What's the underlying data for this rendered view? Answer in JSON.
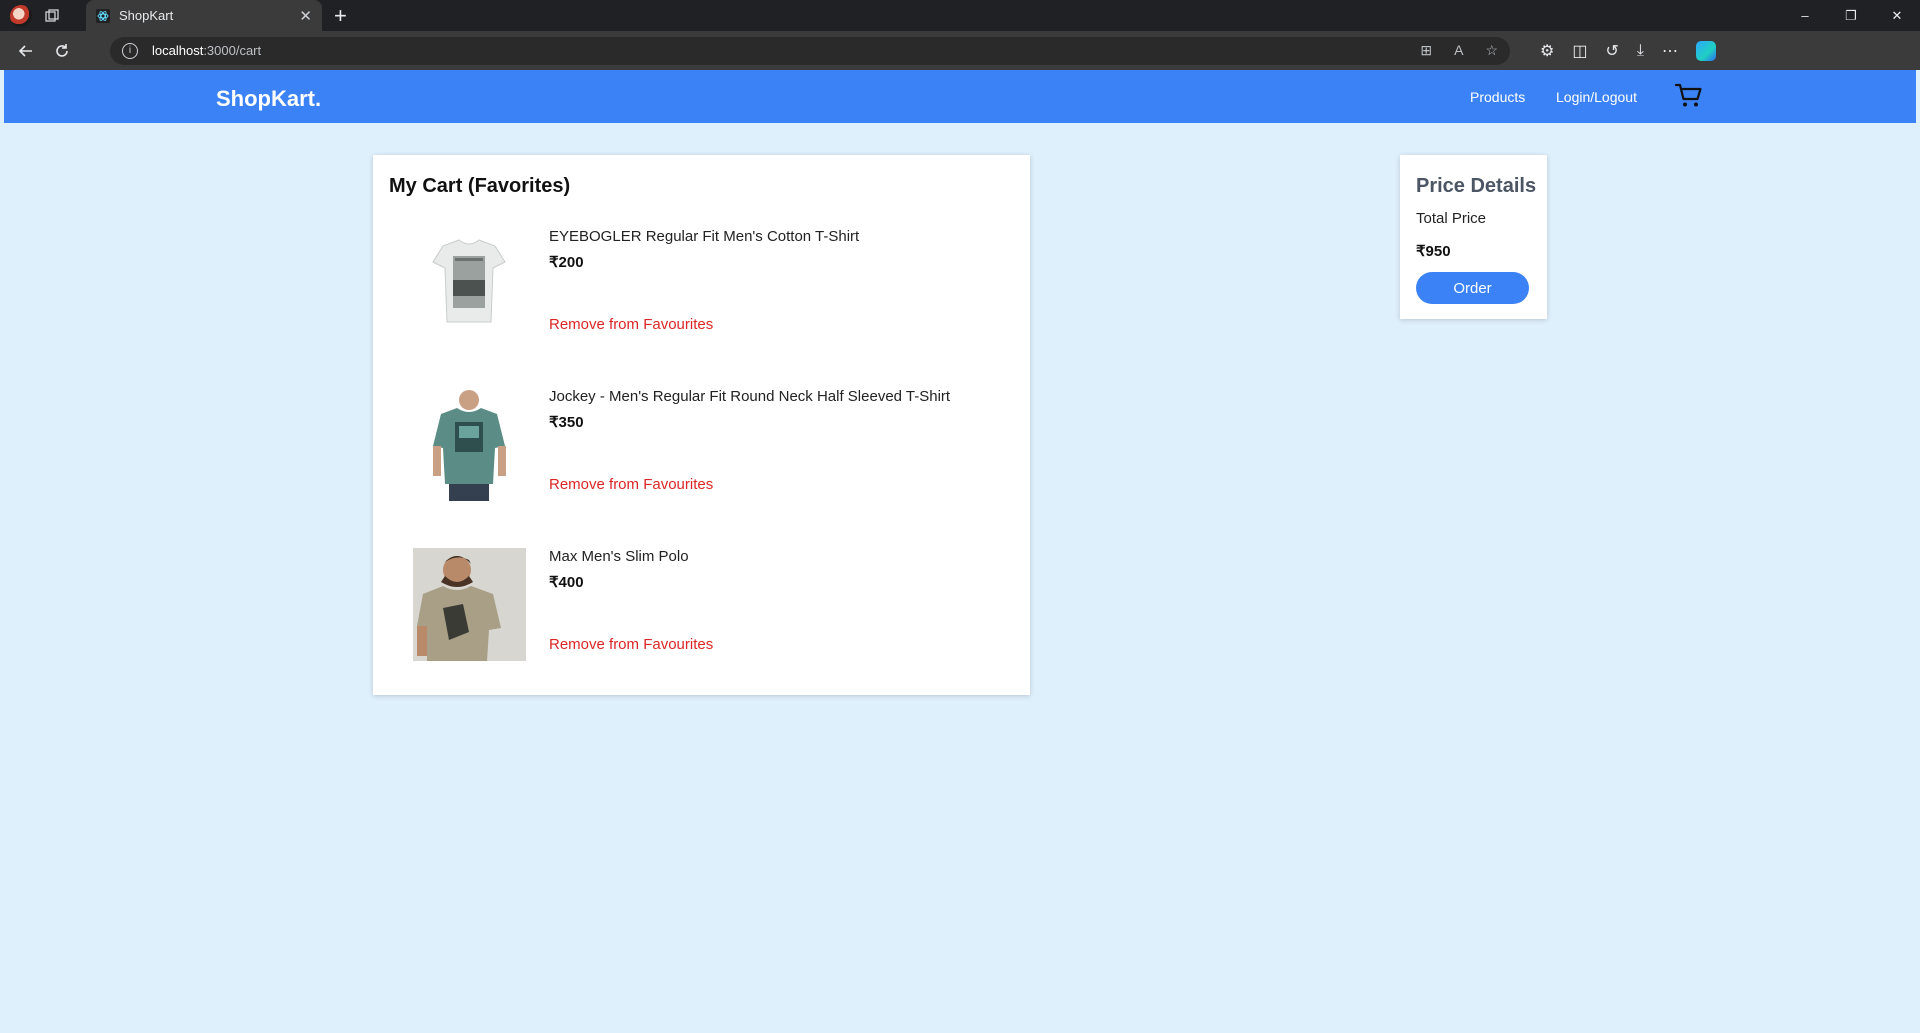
{
  "browser": {
    "tab_title": "ShopKart",
    "tab_close": "✕",
    "new_tab": "+",
    "url_host": "localhost",
    "url_path": ":3000/cart",
    "window_controls": [
      "–",
      "❐",
      "✕"
    ]
  },
  "app": {
    "brand": "ShopKart.",
    "nav": {
      "products": "Products",
      "login": "Login/Logout"
    },
    "accent_color": "#3b82f6",
    "page_background": "#dff0fd"
  },
  "cart": {
    "title": "My Cart (Favorites)",
    "items": [
      {
        "name": "EYEBOGLER Regular Fit Men's Cotton T-Shirt",
        "price": "₹200",
        "remove_label": "Remove from Favourites",
        "image": "white-tshirt"
      },
      {
        "name": "Jockey - Men's Regular Fit Round Neck Half Sleeved T-Shirt",
        "price": "₹350",
        "remove_label": "Remove from Favourites",
        "image": "teal-tshirt-model"
      },
      {
        "name": "Max Men's Slim Polo",
        "price": "₹400",
        "remove_label": "Remove from Favourites",
        "image": "olive-tshirt-model"
      }
    ]
  },
  "price_details": {
    "title": "Price Details",
    "total_label": "Total Price",
    "total_value": "₹950",
    "order_label": "Order"
  }
}
